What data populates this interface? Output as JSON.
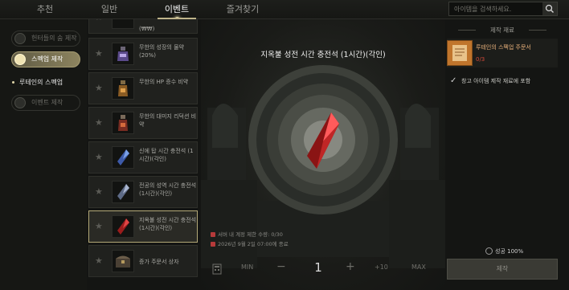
{
  "tabs": [
    {
      "label": "추천",
      "active": false
    },
    {
      "label": "일반",
      "active": false
    },
    {
      "label": "이벤트",
      "active": true
    },
    {
      "label": "즐겨찾기",
      "active": false
    }
  ],
  "search": {
    "placeholder": "아이템을 검색하세요."
  },
  "leftnav": {
    "items": [
      {
        "label": "헌터들의 숨 제작",
        "active": false
      },
      {
        "label": "스펙업 제작",
        "active": true
      },
      {
        "label": "이벤트 제작",
        "active": false
      }
    ],
    "sub_item": "루테인의 스펙업"
  },
  "list": {
    "partial_top_label": "(₩₩)",
    "rows": [
      {
        "label": "무한의 성장의 물약 (20%)",
        "icon": "potion-purple-icon",
        "selected": false
      },
      {
        "label": "무한의 HP 증수 비약",
        "icon": "potion-orange-icon",
        "selected": false
      },
      {
        "label": "무한의 대미지 리덕션 비약",
        "icon": "potion-red-icon",
        "selected": false
      },
      {
        "label": "신에 탑 시간 충전석 (1시간)(각인)",
        "icon": "crystal-blue-icon",
        "selected": false
      },
      {
        "label": "전공의 성역 시간 충전석 (1시간)(각인)",
        "icon": "crystal-steel-icon",
        "selected": false
      },
      {
        "label": "지옥불 성전 시간 충전석 (1시간)(각인)",
        "icon": "crystal-red-icon",
        "selected": true
      },
      {
        "label": "증가 주문서 상자",
        "icon": "chest-icon",
        "selected": false
      }
    ]
  },
  "center": {
    "title": "지옥불 성전 시간 충전석 (1시간)(각인)",
    "limit_text": "서버 내 계정 제한 수량: 0/30",
    "date_text": "2026년 9월 2일 07:00에 종료"
  },
  "quantity": {
    "min_label": "MIN",
    "minus": "−",
    "value": "1",
    "plus": "+",
    "plus10": "+10",
    "max_label": "MAX"
  },
  "right": {
    "materials_title": "제작 재료",
    "material_name": "루테인의 스펙업 주문서",
    "material_count": "0/3",
    "warehouse_label": "창고 아이템 제작 재료에 포함",
    "success_label": "성공",
    "success_rate": "100%",
    "craft_button": "제작"
  },
  "colors": {
    "accent": "#bfb48a",
    "error": "#d24a3a",
    "material": "#e7b07a"
  }
}
